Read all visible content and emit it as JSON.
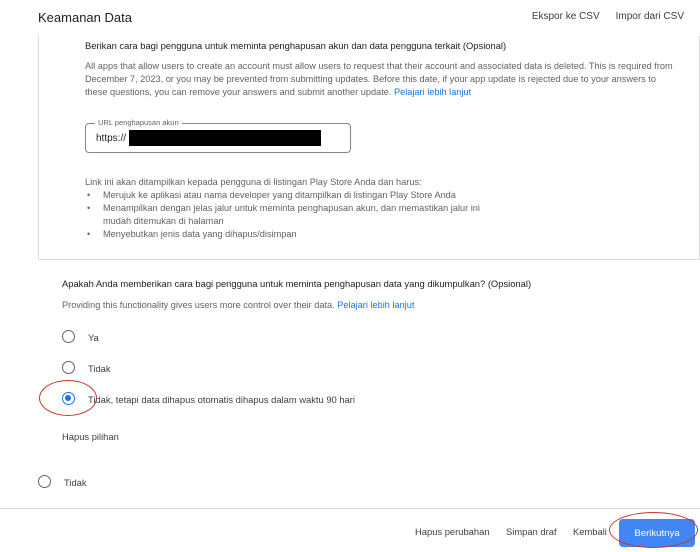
{
  "header": {
    "title": "Keamanan Data",
    "export_label": "Ekspor ke CSV",
    "import_label": "Impor dari CSV"
  },
  "deletion_section": {
    "title": "Berikan cara bagi pengguna untuk meminta penghapusan akun dan data pengguna terkait (Opsional)",
    "description": "All apps that allow users to create an account must allow users to request that their account and associated data is deleted. This is required from December 7, 2023, or you may be prevented from submitting updates. Before this date, if your app update is rejected due to your answers to these questions, you can remove your answers and submit another update.",
    "learn_more": "Pelajari lebih lanjut",
    "url_field": {
      "label": "URL penghapusan akun",
      "value": "https://"
    },
    "info_intro": "Link ini akan ditampilkan kepada pengguna di listingan Play Store Anda dan harus:",
    "bullets": [
      "Merujuk ke aplikasi atau nama developer yang ditampilkan di listingan Play Store Anda",
      "Menampilkan dengan jelas jalur untuk meminta penghapusan akun, dan memastikan jalur ini mudah ditemukan di halaman",
      "Menyebutkan jenis data yang dihapus/disimpan"
    ]
  },
  "data_deletion_question": {
    "title": "Apakah Anda memberikan cara bagi pengguna untuk meminta penghapusan data yang dikumpulkan? (Opsional)",
    "description": "Providing this functionality gives users more control over their data.",
    "learn_more": "Pelajari lebih lanjut",
    "options": [
      {
        "label": "Ya",
        "checked": false
      },
      {
        "label": "Tidak",
        "checked": false
      },
      {
        "label": "Tidak, tetapi data dihapus otomatis dihapus dalam waktu 90 hari",
        "checked": true
      }
    ],
    "clear_label": "Hapus pilihan"
  },
  "extra_option": {
    "label": "Tidak",
    "checked": false
  },
  "footer": {
    "discard_label": "Hapus perubahan",
    "save_draft_label": "Simpan draf",
    "back_label": "Kembali",
    "next_label": "Berikutnya"
  },
  "colors": {
    "accent": "#1a73e8",
    "primary_button": "#4285f4",
    "annotation": "#c0392b"
  }
}
